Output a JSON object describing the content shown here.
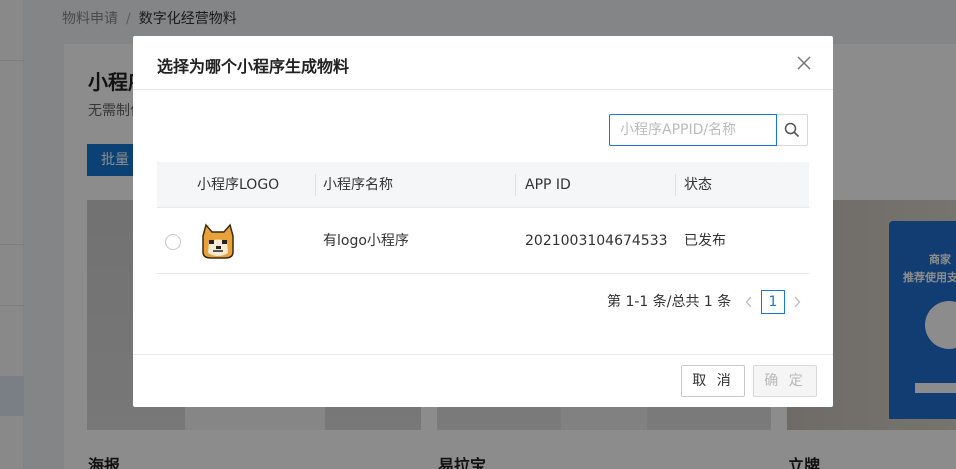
{
  "background": {
    "breadcrumb": [
      "物料申请",
      "数字化经营物料"
    ],
    "breadcrumb_sep": "/",
    "page_title": "小程序",
    "page_desc": "无需制作",
    "batch_button": "批量",
    "cards": [
      "海报",
      "易拉宝",
      "立牌"
    ],
    "stand_text1": "商家",
    "stand_text2": "推荐使用支"
  },
  "modal": {
    "title": "选择为哪个小程序生成物料",
    "search": {
      "placeholder": "小程序APPID/名称",
      "value": ""
    },
    "table": {
      "columns": [
        "小程序LOGO",
        "小程序名称",
        "APP ID",
        "状态"
      ],
      "rows": [
        {
          "logo": "doge-avatar",
          "name": "有logo小程序",
          "app_id": "2021003104674533",
          "status": "已发布",
          "selected": false
        }
      ]
    },
    "pagination": {
      "info": "第 1-1 条/总共 1 条",
      "current": "1"
    },
    "buttons": {
      "cancel": "取 消",
      "ok": "确 定"
    }
  },
  "colors": {
    "primary": "#1677d6",
    "overlay": "rgba(0,0,0,0.45)"
  }
}
